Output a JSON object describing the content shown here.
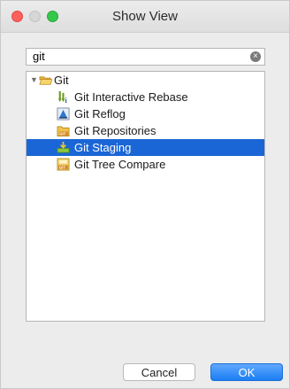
{
  "window": {
    "title": "Show View"
  },
  "search": {
    "value": "git",
    "placeholder": ""
  },
  "tree": {
    "category": "Git",
    "items": [
      {
        "label": "Git Interactive Rebase",
        "icon": "rebase-icon",
        "selected": false
      },
      {
        "label": "Git Reflog",
        "icon": "reflog-icon",
        "selected": false
      },
      {
        "label": "Git Repositories",
        "icon": "repositories-icon",
        "selected": false
      },
      {
        "label": "Git Staging",
        "icon": "staging-icon",
        "selected": true
      },
      {
        "label": "Git Tree Compare",
        "icon": "tree-compare-icon",
        "selected": false
      }
    ]
  },
  "buttons": {
    "cancel": "Cancel",
    "ok": "OK"
  },
  "colors": {
    "selection": "#1b66d6",
    "ok_button": "#1a7ef3"
  }
}
